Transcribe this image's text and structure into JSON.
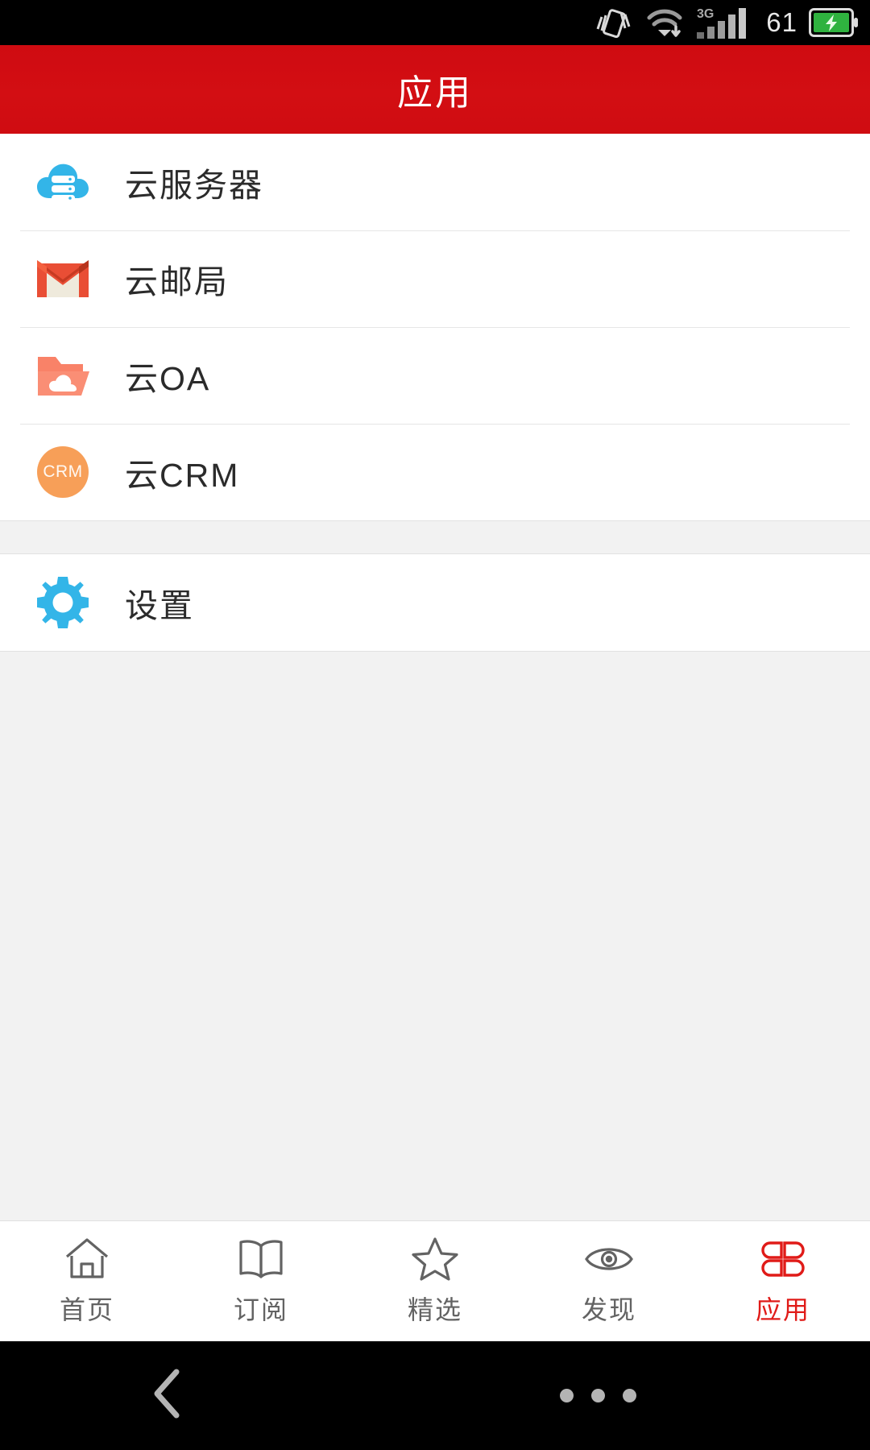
{
  "status_bar": {
    "battery_percent": "61",
    "network_type": "3G",
    "icons": [
      "vibrate-icon",
      "wifi-icon",
      "signal-icon",
      "battery-charging-icon"
    ]
  },
  "header": {
    "title": "应用"
  },
  "apps": {
    "primary": [
      {
        "label": "云服务器",
        "icon": "cloud-server-icon",
        "color": "#33b5e8"
      },
      {
        "label": "云邮局",
        "icon": "gmail-envelope-icon",
        "color": "#e94e35"
      },
      {
        "label": "云OA",
        "icon": "cloud-folder-icon",
        "color": "#f98268"
      },
      {
        "label": "云CRM",
        "icon": "crm-circle-icon",
        "color": "#f79f58",
        "badge_text": "CRM"
      }
    ],
    "secondary": [
      {
        "label": "设置",
        "icon": "gear-icon",
        "color": "#33b5e8"
      }
    ]
  },
  "tabbar": {
    "active_index": 4,
    "active_color": "#e01b18",
    "inactive_color": "#636363",
    "items": [
      {
        "label": "首页",
        "icon": "home-icon"
      },
      {
        "label": "订阅",
        "icon": "book-icon"
      },
      {
        "label": "精选",
        "icon": "star-icon"
      },
      {
        "label": "发现",
        "icon": "eye-icon"
      },
      {
        "label": "应用",
        "icon": "grid-apps-icon"
      }
    ]
  },
  "navbar": {
    "back": "back-chevron-icon",
    "menu": "menu-dots-icon"
  }
}
